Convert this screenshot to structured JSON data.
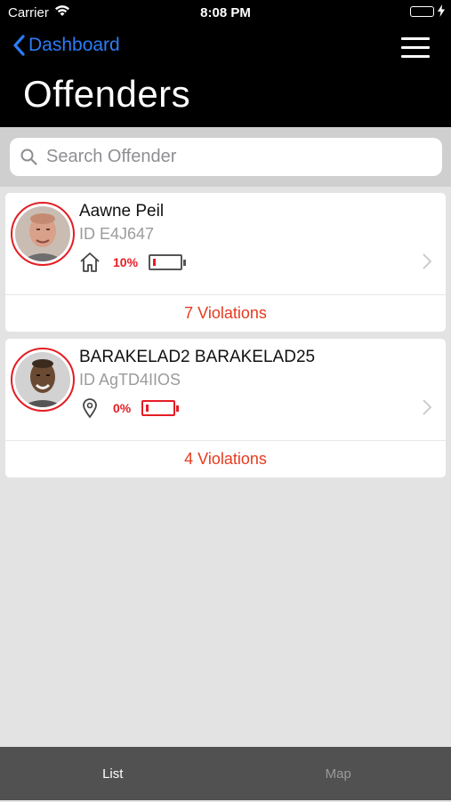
{
  "status_bar": {
    "carrier": "Carrier",
    "time": "8:08 PM",
    "battery_color": "#4cd964"
  },
  "nav": {
    "back_label": "Dashboard",
    "title": "Offenders",
    "back_icon": "chevron-left-icon",
    "menu_icon": "hamburger-menu-icon",
    "accent_color": "#2b7cf6"
  },
  "search": {
    "placeholder": "Search Offender",
    "value": ""
  },
  "offenders": [
    {
      "name": "Aawne Peil",
      "id": "ID E4J647",
      "location_icon": "home-icon",
      "battery_percent": "10%",
      "battery_level": 0.1,
      "violations": "7 Violations"
    },
    {
      "name": "BARAKELAD2 BARAKELAD25",
      "id": "ID AgTD4IIOS",
      "location_icon": "location-pin-icon",
      "battery_percent": "0%",
      "battery_level": 0.0,
      "violations": "4 Violations"
    }
  ],
  "tabs": [
    {
      "label": "List",
      "active": true
    },
    {
      "label": "Map",
      "active": false
    }
  ],
  "colors": {
    "alert_red": "#e41d24",
    "violations_text": "#e63a1e"
  }
}
